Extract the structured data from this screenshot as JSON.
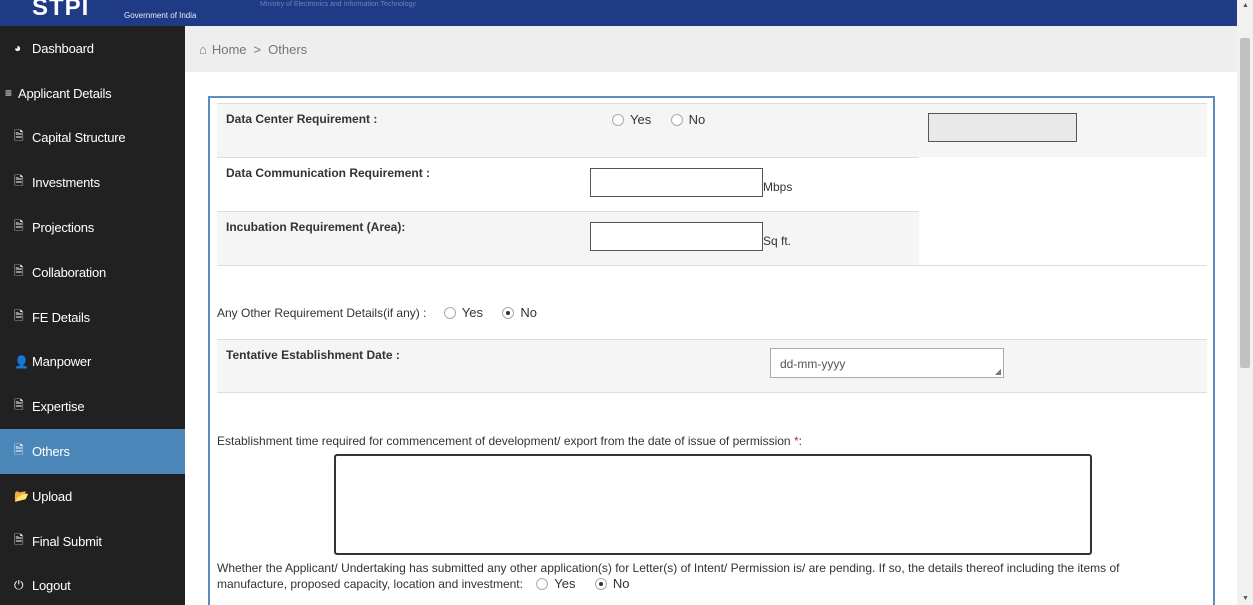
{
  "header": {
    "logo": "STPI",
    "gov_text": "Government of India",
    "faint_text": "Ministry of Electronics and Information Technology"
  },
  "sidebar": {
    "items": [
      {
        "label": "Dashboard",
        "icon": "dashboard-icon",
        "active": false
      },
      {
        "label": "Applicant Details",
        "icon": "list-icon",
        "active": false
      },
      {
        "label": "Capital Structure",
        "icon": "document-icon",
        "active": false
      },
      {
        "label": "Investments",
        "icon": "document-icon",
        "active": false
      },
      {
        "label": "Projections",
        "icon": "document-icon",
        "active": false
      },
      {
        "label": "Collaboration",
        "icon": "document-icon",
        "active": false
      },
      {
        "label": "FE Details",
        "icon": "document-icon",
        "active": false
      },
      {
        "label": "Manpower",
        "icon": "user-icon",
        "active": false
      },
      {
        "label": "Expertise",
        "icon": "document-icon",
        "active": false
      },
      {
        "label": "Others",
        "icon": "document-icon",
        "active": true
      },
      {
        "label": "Upload",
        "icon": "folder-icon",
        "active": false
      },
      {
        "label": "Final Submit",
        "icon": "document-icon",
        "active": false
      },
      {
        "label": "Logout",
        "icon": "power-icon",
        "active": false
      }
    ]
  },
  "breadcrumb": {
    "home": "Home",
    "separator": ">",
    "current": "Others"
  },
  "form": {
    "data_center": {
      "label": "Data Center Requirement :",
      "yes": "Yes",
      "no": "No",
      "selected": null
    },
    "data_comm": {
      "label": "Data Communication Requirement :",
      "value": "",
      "unit": "Mbps"
    },
    "incubation": {
      "label": "Incubation Requirement (Area):",
      "value": "",
      "unit": "Sq ft."
    },
    "other_req": {
      "label": "Any Other Requirement Details(if any) :",
      "yes": "Yes",
      "no": "No",
      "selected": "No"
    },
    "tentative_date": {
      "label": "Tentative Establishment Date :",
      "placeholder": "dd-mm-yyyy"
    },
    "establishment_time": {
      "label": "Establishment time required for commencement of development/ export from the date of issue of permission",
      "required_mark": "*",
      "colon": ":",
      "value": ""
    },
    "other_application": {
      "label_line1": "Whether the Applicant/ Undertaking has submitted any other application(s) for Letter(s) of Intent/ Permission is/ are pending. If so, the details thereof including the items of",
      "label_line2": "manufacture, proposed capacity, location and investment:",
      "yes": "Yes",
      "no": "No",
      "selected": "No"
    }
  },
  "colors": {
    "header_bg": "#1f3b86",
    "sidebar_bg": "#212121",
    "sidebar_active": "#4a86b7",
    "form_border": "#5d8cc2",
    "required": "#e02020"
  }
}
